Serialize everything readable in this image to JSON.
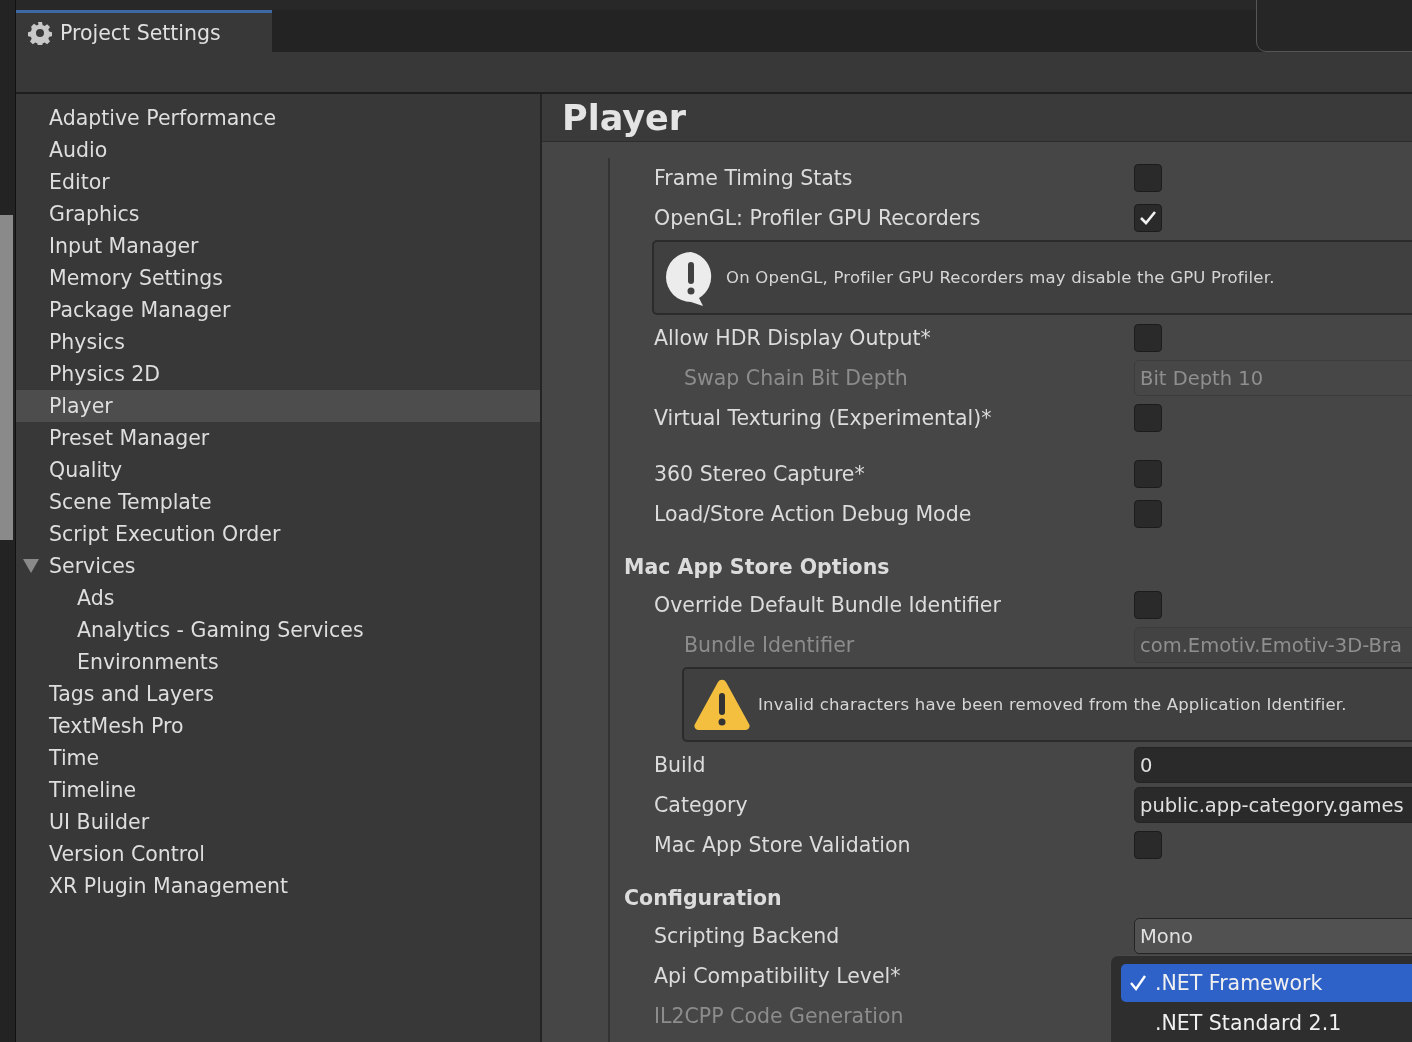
{
  "window": {
    "title": "Project Settings"
  },
  "sidebar": {
    "items": [
      {
        "label": "Adaptive Performance",
        "selected": false
      },
      {
        "label": "Audio",
        "selected": false
      },
      {
        "label": "Editor",
        "selected": false
      },
      {
        "label": "Graphics",
        "selected": false
      },
      {
        "label": "Input Manager",
        "selected": false
      },
      {
        "label": "Memory Settings",
        "selected": false
      },
      {
        "label": "Package Manager",
        "selected": false
      },
      {
        "label": "Physics",
        "selected": false
      },
      {
        "label": "Physics 2D",
        "selected": false
      },
      {
        "label": "Player",
        "selected": true
      },
      {
        "label": "Preset Manager",
        "selected": false
      },
      {
        "label": "Quality",
        "selected": false
      },
      {
        "label": "Scene Template",
        "selected": false
      },
      {
        "label": "Script Execution Order",
        "selected": false
      },
      {
        "label": "Services",
        "selected": false,
        "expanded": true,
        "children": [
          {
            "label": "Ads",
            "selected": false
          },
          {
            "label": "Analytics - Gaming Services",
            "selected": false
          },
          {
            "label": "Environments",
            "selected": false
          }
        ]
      },
      {
        "label": "Tags and Layers",
        "selected": false
      },
      {
        "label": "TextMesh Pro",
        "selected": false
      },
      {
        "label": "Time",
        "selected": false
      },
      {
        "label": "Timeline",
        "selected": false
      },
      {
        "label": "UI Builder",
        "selected": false
      },
      {
        "label": "Version Control",
        "selected": false
      },
      {
        "label": "XR Plugin Management",
        "selected": false
      }
    ]
  },
  "panel": {
    "title": "Player",
    "rows": [
      {
        "kind": "toggle",
        "label": "Frame Timing Stats",
        "checked": false,
        "indented": false,
        "disabled": false
      },
      {
        "kind": "toggle",
        "label": "OpenGL: Profiler GPU Recorders",
        "checked": true,
        "indented": false,
        "disabled": false
      },
      {
        "kind": "info_box",
        "text": "On OpenGL, Profiler GPU Recorders may disable the GPU Profiler.",
        "indented": false
      },
      {
        "kind": "toggle",
        "label": "Allow HDR Display Output*",
        "checked": false,
        "indented": false,
        "disabled": false
      },
      {
        "kind": "dropdown",
        "label": "Swap Chain Bit Depth",
        "value": "Bit Depth 10",
        "indented": true,
        "disabled": true
      },
      {
        "kind": "toggle",
        "label": "Virtual Texturing (Experimental)*",
        "checked": false,
        "indented": false,
        "disabled": false
      },
      {
        "kind": "spacer"
      },
      {
        "kind": "toggle",
        "label": "360 Stereo Capture*",
        "checked": false,
        "indented": false,
        "disabled": false
      },
      {
        "kind": "toggle",
        "label": "Load/Store Action Debug Mode",
        "checked": false,
        "indented": false,
        "disabled": false
      },
      {
        "kind": "section",
        "label": "Mac App Store Options"
      },
      {
        "kind": "toggle",
        "label": "Override Default Bundle Identifier",
        "checked": false,
        "indented": false,
        "disabled": false
      },
      {
        "kind": "text",
        "label": "Bundle Identifier",
        "value": "com.Emotiv.Emotiv-3D-Bra",
        "indented": true,
        "disabled": true
      },
      {
        "kind": "warning_box",
        "text": "Invalid characters have been removed from the Application Identifier.",
        "indented": true
      },
      {
        "kind": "text",
        "label": "Build",
        "value": "0",
        "indented": false,
        "disabled": false
      },
      {
        "kind": "text",
        "label": "Category",
        "value": "public.app-category.games",
        "indented": false,
        "disabled": false
      },
      {
        "kind": "toggle",
        "label": "Mac App Store Validation",
        "checked": false,
        "indented": false,
        "disabled": false
      },
      {
        "kind": "section",
        "label": "Configuration"
      },
      {
        "kind": "dropdown",
        "label": "Scripting Backend",
        "value": "Mono",
        "indented": false,
        "disabled": false
      },
      {
        "kind": "label",
        "label": "Api Compatibility Level*",
        "indented": false,
        "disabled": false
      },
      {
        "kind": "label",
        "label": "IL2CPP Code Generation",
        "indented": false,
        "disabled": true
      }
    ]
  },
  "popup": {
    "options": [
      {
        "label": ".NET Framework",
        "selected": true
      },
      {
        "label": ".NET Standard 2.1",
        "selected": false
      }
    ]
  }
}
